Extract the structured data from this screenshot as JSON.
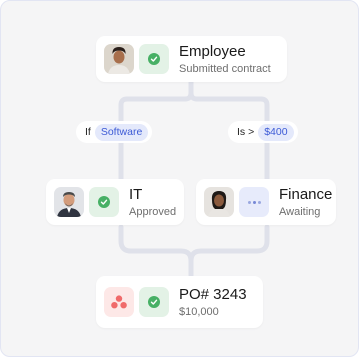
{
  "nodes": {
    "employee": {
      "title": "Employee",
      "subtitle": "Submitted contract",
      "status": "approved"
    },
    "it": {
      "title": "IT",
      "subtitle": "Approved",
      "status": "approved"
    },
    "finance": {
      "title": "Finance",
      "subtitle": "Awaiting",
      "status": "awaiting"
    },
    "po": {
      "title": "PO# 3243",
      "subtitle": "$10,000",
      "status": "approved"
    }
  },
  "conditions": {
    "left": {
      "prefix": "If",
      "value": "Software"
    },
    "right": {
      "prefix": "Is >",
      "value": "$400"
    }
  },
  "colors": {
    "approved_check": "#47b065",
    "approved_bg": "#e3f2e6",
    "awaiting_bg": "#e7ebfb",
    "chip_text": "#3d5bd6",
    "chip_bg": "#e4e9fb",
    "brand_logo": "#f06a6a"
  },
  "icons": {
    "approved": "check-circle-icon",
    "awaiting": "dots-icon",
    "brand": "asana-logo-icon"
  }
}
